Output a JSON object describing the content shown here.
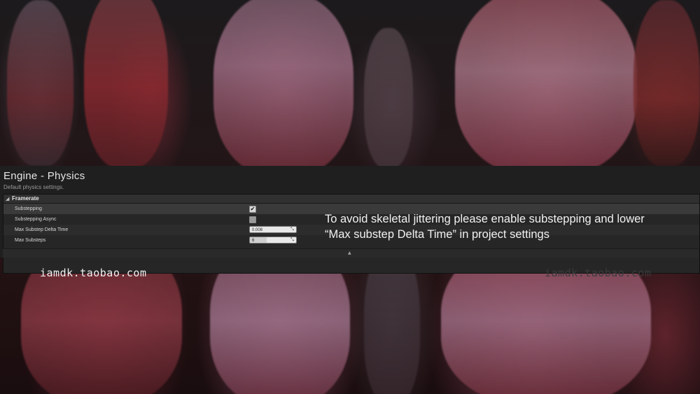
{
  "panel": {
    "title": "Engine - Physics",
    "description": "Default physics settings.",
    "category": {
      "label": "Framerate",
      "rows": [
        {
          "label": "Substepping",
          "type": "checkbox",
          "checked": true
        },
        {
          "label": "Substepping Async",
          "type": "checkbox",
          "checked": false
        },
        {
          "label": "Max Substep Delta Time",
          "type": "number",
          "value": "0.008"
        },
        {
          "label": "Max Substeps",
          "type": "number",
          "value": "6"
        }
      ]
    }
  },
  "overlay": {
    "line1": "To avoid skeletal jittering please  enable substepping and lower",
    "line2": "“Max substep Delta Time” in project settings"
  },
  "watermarks": {
    "left": "iamdk.taobao.com",
    "right": "iamdk.taobao.com"
  },
  "icons": {
    "expand": "triangle-down-icon",
    "check": "checkmark-icon",
    "spin": "spinner-arrows-icon",
    "collapse": "triangle-up-icon"
  }
}
